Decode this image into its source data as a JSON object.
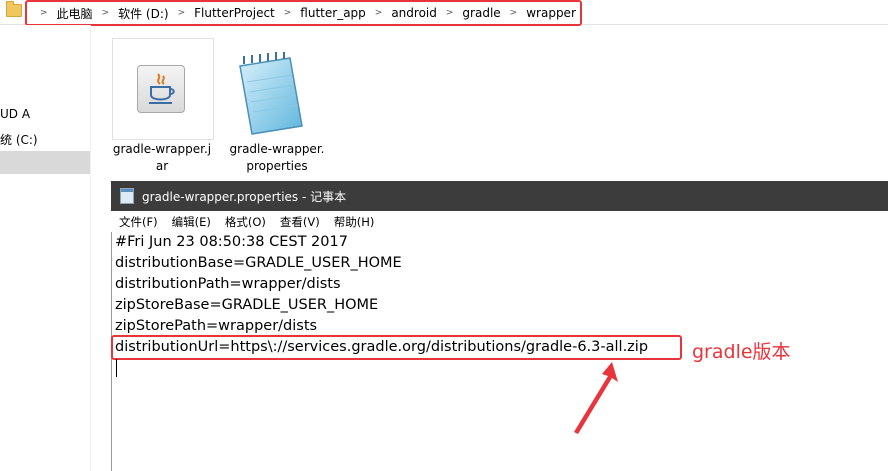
{
  "breadcrumb": [
    "此电脑",
    "软件 (D:)",
    "FlutterProject",
    "flutter_app",
    "android",
    "gradle",
    "wrapper"
  ],
  "nav": {
    "items": [
      {
        "label": "UD A"
      },
      {
        "label": "统 (C:)"
      }
    ]
  },
  "files": [
    {
      "name_line1": "gradle-wrapper.j",
      "name_line2": "ar",
      "icon": "java-jar-icon"
    },
    {
      "name_line1": "gradle-wrapper.",
      "name_line2": "properties",
      "icon": "notepad-file-icon"
    }
  ],
  "notepad": {
    "title": "gradle-wrapper.properties - 记事本",
    "menu": [
      "文件(F)",
      "编辑(E)",
      "格式(O)",
      "查看(V)",
      "帮助(H)"
    ],
    "lines": [
      "#Fri Jun 23 08:50:38 CEST 2017",
      "distributionBase=GRADLE_USER_HOME",
      "distributionPath=wrapper/dists",
      "zipStoreBase=GRADLE_USER_HOME",
      "zipStorePath=wrapper/dists",
      "distributionUrl=https\\://services.gradle.org/distributions/gradle-6.3-all.zip"
    ]
  },
  "annotation": {
    "label": "gradle版本",
    "color": "#e8343b"
  }
}
